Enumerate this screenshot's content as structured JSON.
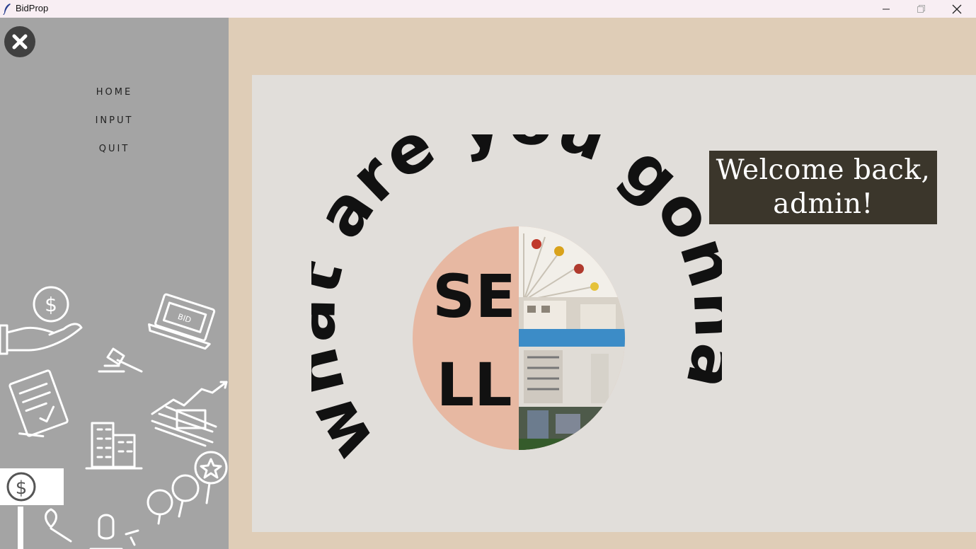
{
  "window": {
    "title": "BidProp"
  },
  "sidebar": {
    "nav": [
      {
        "label": "HOME"
      },
      {
        "label": "INPUT"
      },
      {
        "label": "QUIT"
      }
    ]
  },
  "main": {
    "welcome_line1": "Welcome back,",
    "welcome_line2": "admin!",
    "logo": {
      "arc_text": "what are you gonna",
      "center_line1": "SE",
      "center_line2": "LL"
    }
  },
  "colors": {
    "titlebar": "#f8eef3",
    "sidebar": "#a4a4a4",
    "main_bg": "#dfcdb7",
    "card": "#e1deda",
    "welcome_bg": "#3b362b",
    "logo_circle": "#e7b8a2"
  }
}
